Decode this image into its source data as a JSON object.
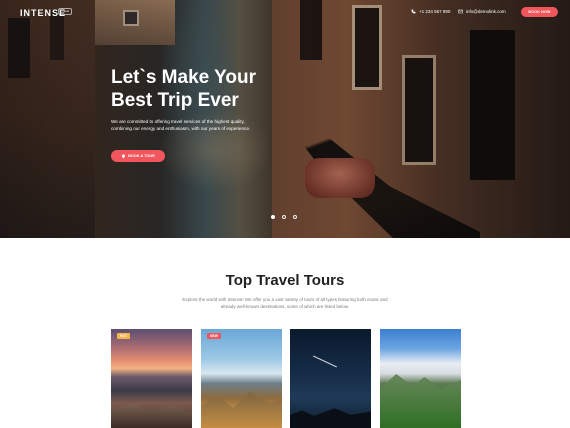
{
  "header": {
    "logo_text": "INTENSE",
    "logo_badge": "Travel",
    "phone": "+1 234 567 890",
    "email": "info@demolink.com",
    "book_now_label": "BOOK NOW"
  },
  "hero": {
    "title_line1": "Let`s Make Your",
    "title_line2": "Best Trip Ever",
    "description": "We are committed to offering travel services of the highest quality, combining our energy and enthusiasm, with our years of experience.",
    "cta_label": "BOOK A TOUR",
    "slides": [
      {
        "active": true
      },
      {
        "active": false
      },
      {
        "active": false
      }
    ]
  },
  "tours_section": {
    "title": "Top Travel Tours",
    "description": "Explore the world with Intense! We offer you a vast variety of tours of all types featuring both exotic and already well-known destinations, some of which are listed below.",
    "cards": [
      {
        "badge": "HOT"
      },
      {
        "badge": "NEW"
      },
      {
        "badge": ""
      },
      {
        "badge": ""
      }
    ]
  },
  "colors": {
    "accent": "#f0565b",
    "hot_badge": "#f3b54a"
  }
}
